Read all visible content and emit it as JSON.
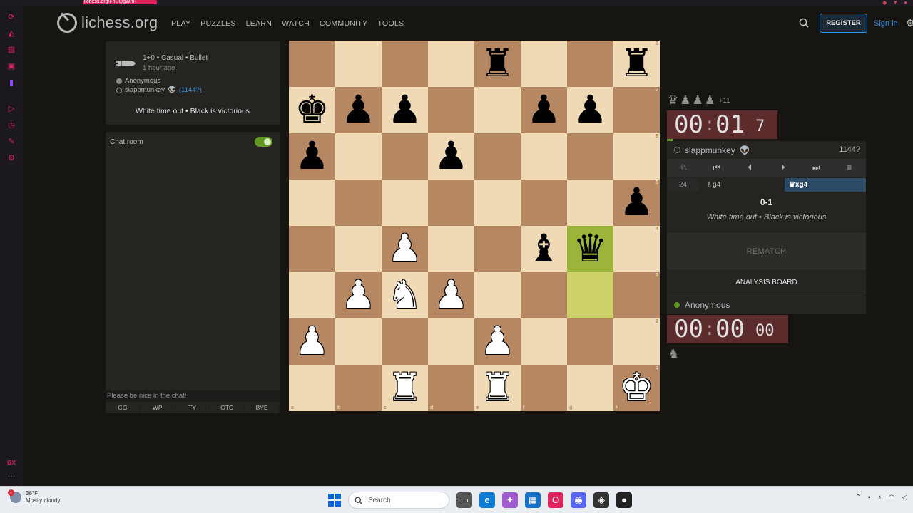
{
  "browser": {
    "url": "lichess.org/FhUQgWnF",
    "rail_bottom_label": "GX"
  },
  "header": {
    "logo_text": "lichess.org",
    "nav": [
      "PLAY",
      "PUZZLES",
      "LEARN",
      "WATCH",
      "COMMUNITY",
      "TOOLS"
    ],
    "register_label": "REGISTER",
    "signin_label": "Sign in"
  },
  "game_info": {
    "mode": "1+0 • Casual • Bullet",
    "time_ago": "1 hour ago",
    "white_player": "Anonymous",
    "black_player": "slappmunkey",
    "black_icon": "👽",
    "black_rating": "(1144?)",
    "result_text": "White time out • Black is victorious"
  },
  "chat": {
    "title": "Chat room",
    "enabled": true,
    "placeholder": "Please be nice in the chat!",
    "presets": [
      "GG",
      "WP",
      "TY",
      "GTG",
      "BYE"
    ]
  },
  "board": {
    "orientation": "white",
    "colors": {
      "light": "#f0d9b5",
      "dark": "#b58863",
      "last_move": "#9bb43a"
    },
    "last_move": [
      "g3",
      "g4"
    ],
    "pieces": {
      "e8": "r",
      "h8": "r",
      "a7": "k",
      "b7": "p",
      "c7": "p",
      "f7": "p",
      "g7": "p",
      "a6": "p",
      "d6": "p",
      "h5": "p",
      "c4": "P",
      "f4": "b",
      "g4": "q",
      "b3": "P",
      "c3": "N",
      "d3": "P",
      "a2": "P",
      "e2": "P",
      "c1": "R",
      "e1": "R",
      "h1": "K"
    }
  },
  "right_panel": {
    "material_pieces": [
      "♛",
      "♟",
      "♟",
      "♟"
    ],
    "material_adv": "+11",
    "top_clock": {
      "hh": "00",
      "mm": "01",
      "frac": "7"
    },
    "top_player": {
      "name": "slappmunkey",
      "icon": "👽",
      "rating": "1144?"
    },
    "controls": [
      "flip-board",
      "first",
      "previous",
      "next",
      "last",
      "menu"
    ],
    "move": {
      "number": "24",
      "white": "♗g4",
      "black": "♛xg4"
    },
    "score": "0-1",
    "status": "White time out • Black is victorious",
    "rematch_label": "REMATCH",
    "analysis_label": "ANALYSIS BOARD",
    "bottom_player": {
      "name": "Anonymous"
    },
    "bottom_clock": {
      "hh": "00",
      "mm": "00",
      "frac": "00"
    }
  },
  "taskbar": {
    "temperature": "38°F",
    "weather": "Mostly cloudy",
    "search_label": "Search",
    "notification_count": "1"
  }
}
